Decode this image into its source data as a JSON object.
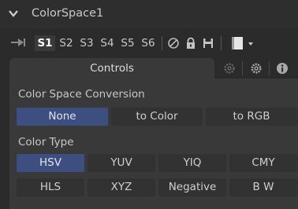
{
  "header": {
    "tool_name": "ColorSpace1"
  },
  "toolbar": {
    "slots": [
      "S1",
      "S2",
      "S3",
      "S4",
      "S5",
      "S6"
    ],
    "active_slot": "S1",
    "icons": [
      "pin-icon",
      "disable-icon",
      "lock-icon",
      "save-icon",
      "color-swatch-dropdown-icon"
    ]
  },
  "tabs": {
    "controls_label": "Controls",
    "icons": [
      "settings-icon",
      "gear-icon",
      "info-icon"
    ]
  },
  "conversion": {
    "label": "Color Space Conversion",
    "options": [
      "None",
      "to Color",
      "to RGB"
    ],
    "selected": "None"
  },
  "color_type": {
    "label": "Color Type",
    "options": [
      "HSV",
      "YUV",
      "YIQ",
      "CMY",
      "HLS",
      "XYZ",
      "Negative",
      "B W"
    ],
    "selected": "HSV"
  },
  "colors": {
    "accent": "#3c4f80",
    "panel": "#393939",
    "background": "#2b2b2b"
  }
}
